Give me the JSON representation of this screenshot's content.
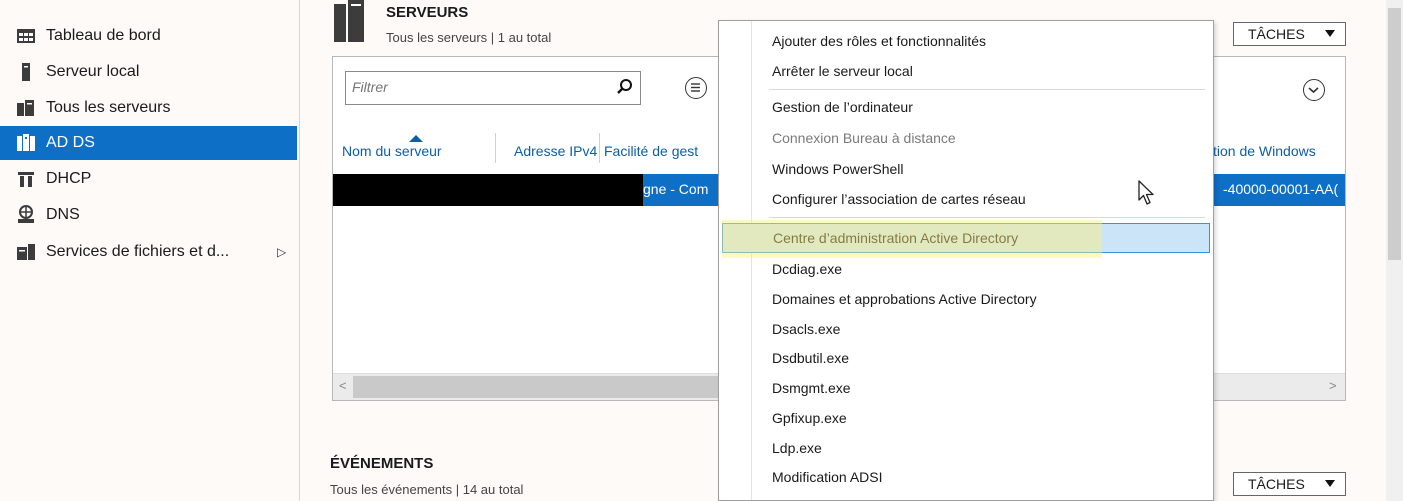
{
  "sidebar": {
    "items": [
      {
        "label": "Tableau de bord",
        "icon": "dashboard-icon"
      },
      {
        "label": "Serveur local",
        "icon": "local-server-icon"
      },
      {
        "label": "Tous les serveurs",
        "icon": "all-servers-icon"
      },
      {
        "label": "AD DS",
        "icon": "ad-ds-icon",
        "active": true
      },
      {
        "label": "DHCP",
        "icon": "dhcp-icon"
      },
      {
        "label": "DNS",
        "icon": "dns-icon"
      },
      {
        "label": "Services de fichiers et d...",
        "icon": "file-services-icon",
        "arrow": "▷"
      }
    ]
  },
  "servers": {
    "title": "SERVEURS",
    "subtitle": "Tous les serveurs | 1 au total",
    "tasks_label": "TÂCHES",
    "filter_placeholder": "Filtrer",
    "columns": [
      "Nom du serveur",
      "Adresse IPv4",
      "Facilité de gest",
      "tion de Windows"
    ],
    "row_fragment_left": "gne - Com",
    "row_fragment_right": "-40000-00001-AA("
  },
  "events": {
    "title": "ÉVÉNEMENTS",
    "subtitle": "Tous les événements | 14 au total",
    "tasks_label": "TÂCHES"
  },
  "context_menu": {
    "items": [
      {
        "label": "Ajouter des rôles et fonctionnalités"
      },
      {
        "label": "Arrêter le serveur local"
      },
      {
        "label": "Gestion de l’ordinateur"
      },
      {
        "label": "Connexion Bureau à distance",
        "disabled": true
      },
      {
        "label": "Windows PowerShell"
      },
      {
        "label": "Configurer l’association de cartes réseau"
      },
      {
        "label": "Centre d’administration Active Directory",
        "hover": true
      },
      {
        "label": "Dcdiag.exe"
      },
      {
        "label": "Domaines et approbations Active Directory"
      },
      {
        "label": "Dsacls.exe"
      },
      {
        "label": "Dsdbutil.exe"
      },
      {
        "label": "Dsmgmt.exe"
      },
      {
        "label": "Gpfixup.exe"
      },
      {
        "label": "Ldp.exe"
      },
      {
        "label": "Modification ADSI"
      }
    ]
  },
  "colors": {
    "accent": "#0e6fc7",
    "hover": "#cce4f7",
    "highlight": "#fff078"
  }
}
